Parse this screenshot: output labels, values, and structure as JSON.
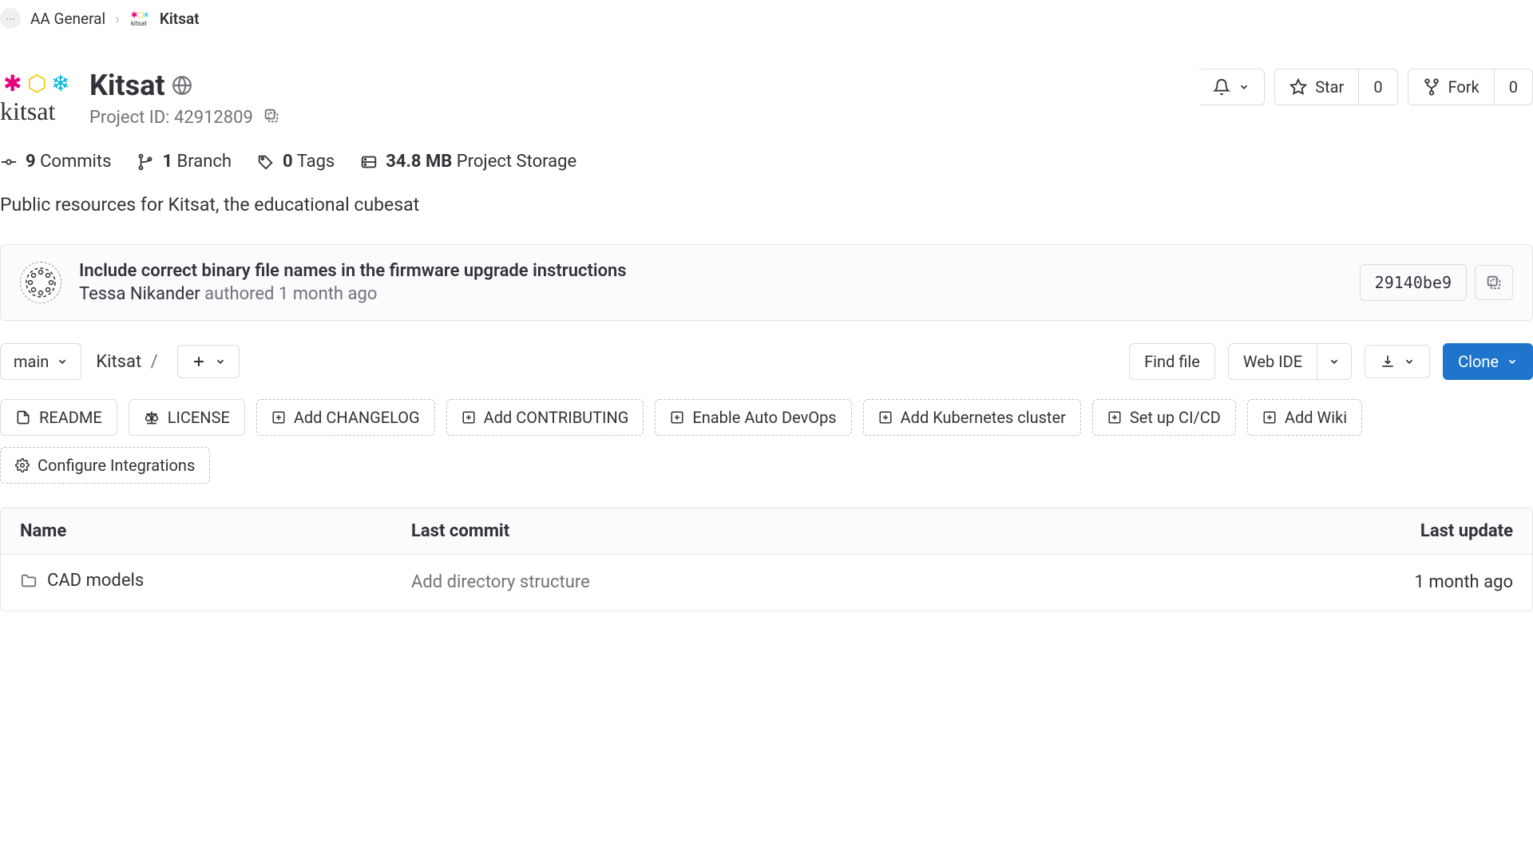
{
  "breadcrumb": {
    "parent": "AA General",
    "current": "Kitsat"
  },
  "project": {
    "title": "Kitsat",
    "id_label": "Project ID: 42912809",
    "description": "Public resources for Kitsat, the educational cubesat"
  },
  "actions": {
    "star_label": "Star",
    "star_count": "0",
    "fork_label": "Fork",
    "fork_count": "0"
  },
  "stats": {
    "commits_count": "9",
    "commits_label": "Commits",
    "branch_count": "1",
    "branch_label": "Branch",
    "tags_count": "0",
    "tags_label": "Tags",
    "storage_size": "34.8 MB",
    "storage_label": "Project Storage"
  },
  "commit": {
    "title": "Include correct binary file names in the firmware upgrade instructions",
    "author": "Tessa Nikander",
    "authored_label": "authored",
    "time_ago": "1 month ago",
    "sha": "29140be9"
  },
  "toolbar": {
    "branch": "main",
    "path_root": "Kitsat",
    "find_file": "Find file",
    "web_ide": "Web IDE",
    "clone": "Clone"
  },
  "quicklinks": {
    "readme": "README",
    "license": "LICENSE",
    "add_changelog": "Add CHANGELOG",
    "add_contributing": "Add CONTRIBUTING",
    "enable_auto_devops": "Enable Auto DevOps",
    "add_kubernetes": "Add Kubernetes cluster",
    "setup_cicd": "Set up CI/CD",
    "add_wiki": "Add Wiki",
    "configure_integrations": "Configure Integrations"
  },
  "files": {
    "header_name": "Name",
    "header_commit": "Last commit",
    "header_update": "Last update",
    "rows": [
      {
        "name": "CAD models",
        "commit": "Add directory structure",
        "update": "1 month ago"
      }
    ]
  }
}
